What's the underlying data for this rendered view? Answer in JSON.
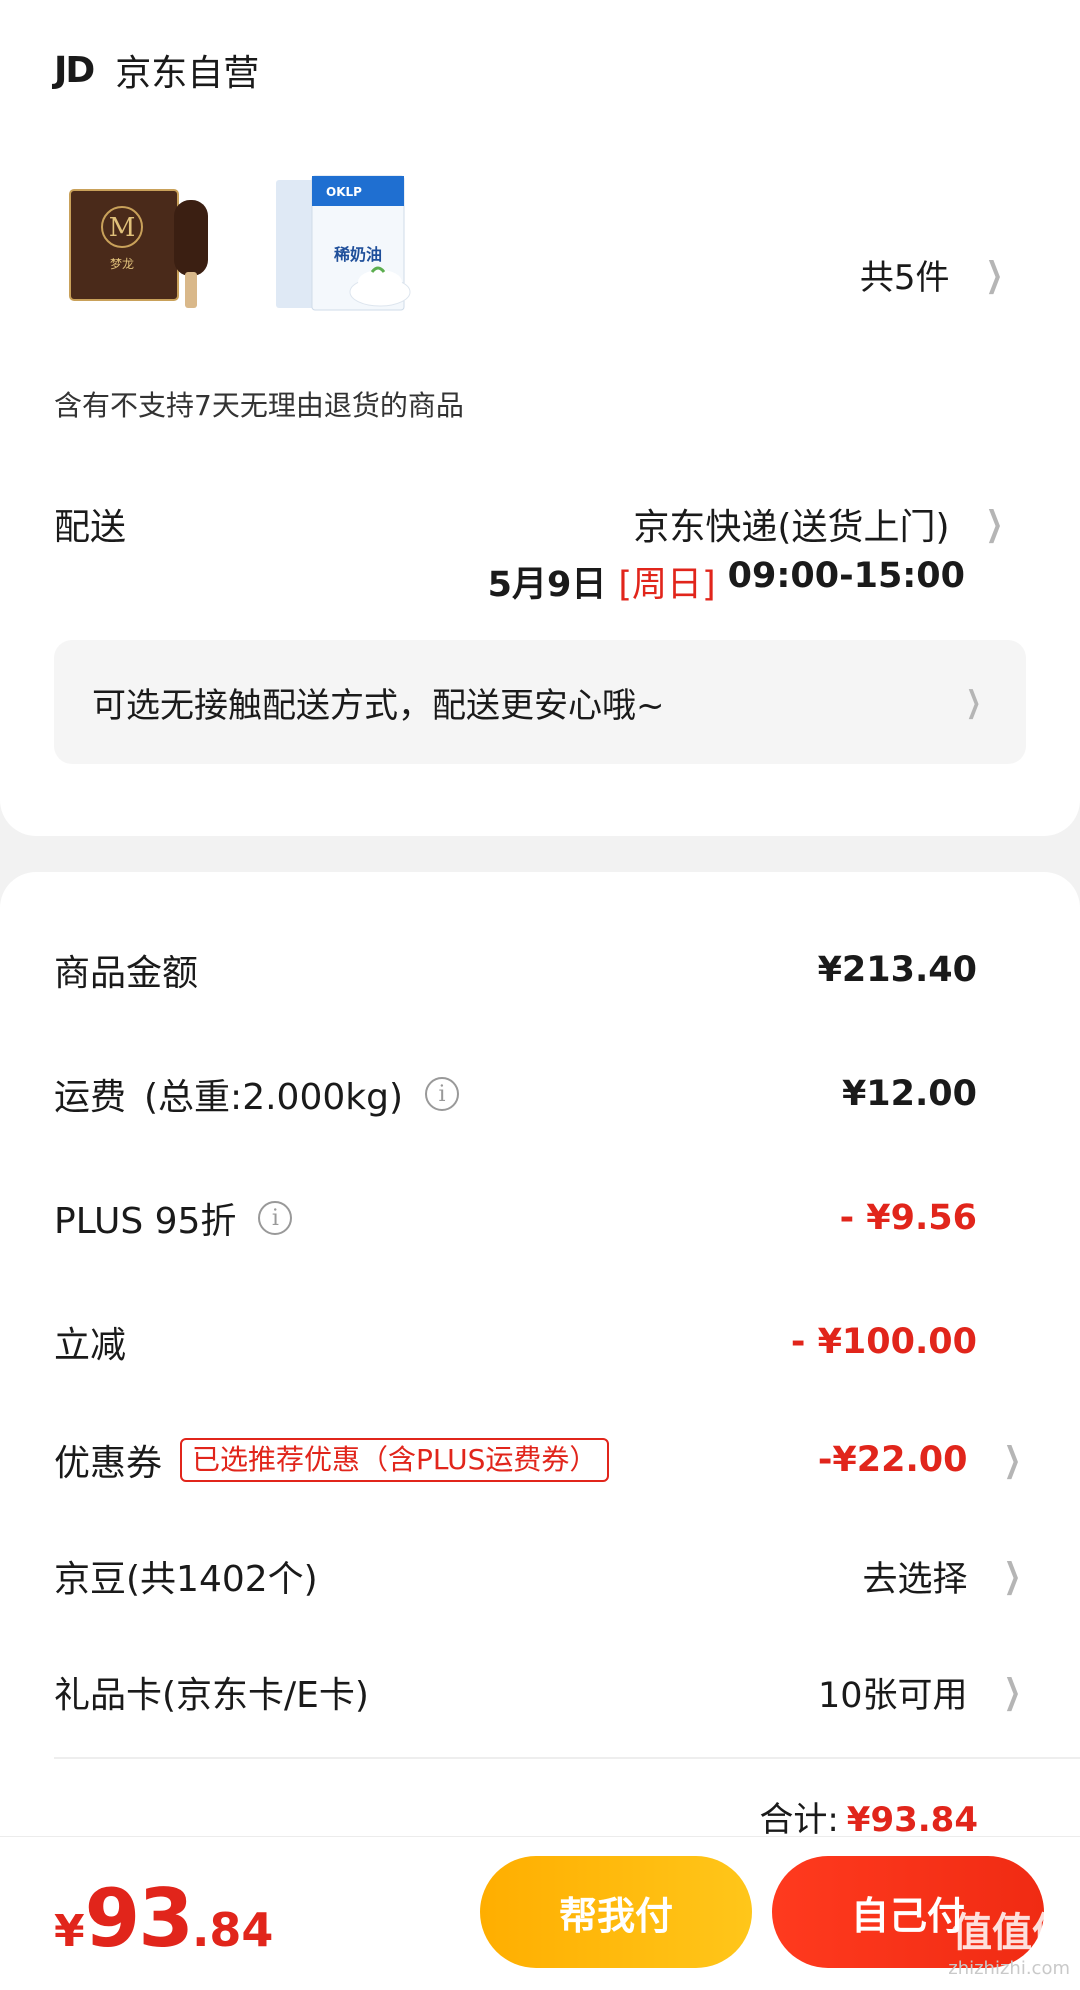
{
  "store": {
    "logo_text": "JD",
    "name": "京东自营"
  },
  "products": {
    "items": [
      {
        "name": "梦龙",
        "brand": "MAGNUM",
        "image": "ice-cream-box"
      },
      {
        "name": "稀奶油",
        "brand": "OKLP 欧凯",
        "image": "cream-carton"
      }
    ],
    "count_label": "共5件"
  },
  "notice": "含有不支持7天无理由退货的商品",
  "shipping": {
    "label": "配送",
    "method": "京东快递(送货上门)",
    "date": "5月9日",
    "weekday": "[周日]",
    "time_range": "09:00-15:00"
  },
  "contactless": {
    "text": "可选无接触配送方式，配送更安心哦~"
  },
  "fees": {
    "goods_amount": {
      "label": "商品金额",
      "value": "¥213.40"
    },
    "freight": {
      "label": "运费",
      "weight": "(总重:2.000kg)",
      "value": "¥12.00"
    },
    "plus_discount": {
      "label": "PLUS 95折",
      "value": "- ¥9.56"
    },
    "instant_reduction": {
      "label": "立减",
      "value": "- ¥100.00"
    },
    "coupon": {
      "label": "优惠券",
      "tag": "已选推荐优惠（含PLUS运费券）",
      "value": "-¥22.00"
    },
    "jd_beans": {
      "label": "京豆(共1402个)",
      "value": "去选择"
    },
    "gift_card": {
      "label": "礼品卡(京东卡/E卡)",
      "value": "10张可用"
    }
  },
  "total": {
    "label": "合计:",
    "amount": "¥93.84"
  },
  "bottom": {
    "price_symbol": "¥",
    "price_int": "93",
    "price_dec": ".84",
    "help_pay_label": "帮我付",
    "self_pay_label": "自己付"
  },
  "watermark": {
    "text": "值值值",
    "url": "zhizhizhi.com"
  },
  "colors": {
    "accent_red": "#e1251b",
    "help_btn": "#ffb800",
    "self_btn": "#f52e16"
  }
}
